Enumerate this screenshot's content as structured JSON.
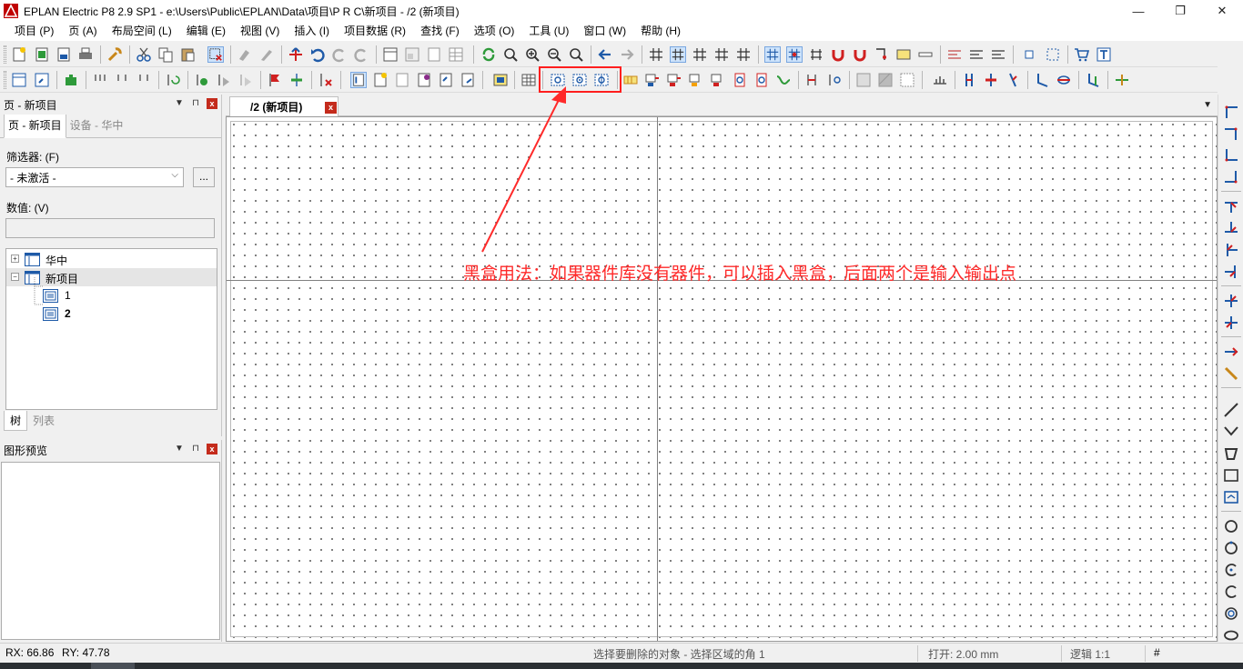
{
  "window": {
    "title": "EPLAN Electric P8 2.9 SP1 - e:\\Users\\Public\\EPLAN\\Data\\项目\\P R C\\新项目 - /2 (新项目)",
    "minimize_glyph": "—",
    "restore_glyph": "❐",
    "close_glyph": "✕"
  },
  "menu": [
    {
      "label": "项目 (P)"
    },
    {
      "label": "页 (A)"
    },
    {
      "label": "布局空间 (L)"
    },
    {
      "label": "编辑 (E)"
    },
    {
      "label": "视图 (V)"
    },
    {
      "label": "插入 (I)"
    },
    {
      "label": "项目数据 (R)"
    },
    {
      "label": "查找 (F)"
    },
    {
      "label": "选项 (O)"
    },
    {
      "label": "工具 (U)"
    },
    {
      "label": "窗口 (W)"
    },
    {
      "label": "帮助 (H)"
    }
  ],
  "page_panel": {
    "title": "页 - 新项目",
    "pin_glyph": "▼",
    "pin2_glyph": "⊓",
    "close_glyph": "x",
    "tabs": [
      "页 - 新项目",
      "设备 - 华中"
    ],
    "filter_label": "筛选器: (F)",
    "filter_value": "- 未激活 -",
    "filter_more": "...",
    "value_label": "数值: (V)",
    "value_text": "",
    "tree": [
      {
        "label": "华中",
        "level": 0,
        "expander": "+"
      },
      {
        "label": "新项目",
        "level": 0,
        "expander": "−",
        "selected": true
      },
      {
        "label": "1",
        "level": 1
      },
      {
        "label": "2",
        "level": 1,
        "bold": true
      }
    ],
    "bottom_tabs": [
      "树",
      "列表"
    ]
  },
  "preview_panel": {
    "title": "图形预览",
    "close_glyph": "x"
  },
  "document": {
    "tab_label": "/2 (新项目)",
    "tab_close": "x",
    "dropdown_glyph": "▼"
  },
  "annotation": {
    "text": "黑盒用法：如果器件库没有器件，可以插入黑盒，后面两个是输入输出点",
    "color": "#ff2a2a"
  },
  "status": {
    "rx": "RX: 66.86",
    "ry": "RY: 47.78",
    "message": "选择要删除的对象 - 选择区域的角 1",
    "open": "打开: 2.00 mm",
    "logic": "逻辑 1:1",
    "hash": "#"
  },
  "colors": {
    "accent_red": "#ff1e1e",
    "icon_blue": "#1e5aa8",
    "icon_green": "#2e9a3a",
    "icon_red": "#d02020"
  }
}
